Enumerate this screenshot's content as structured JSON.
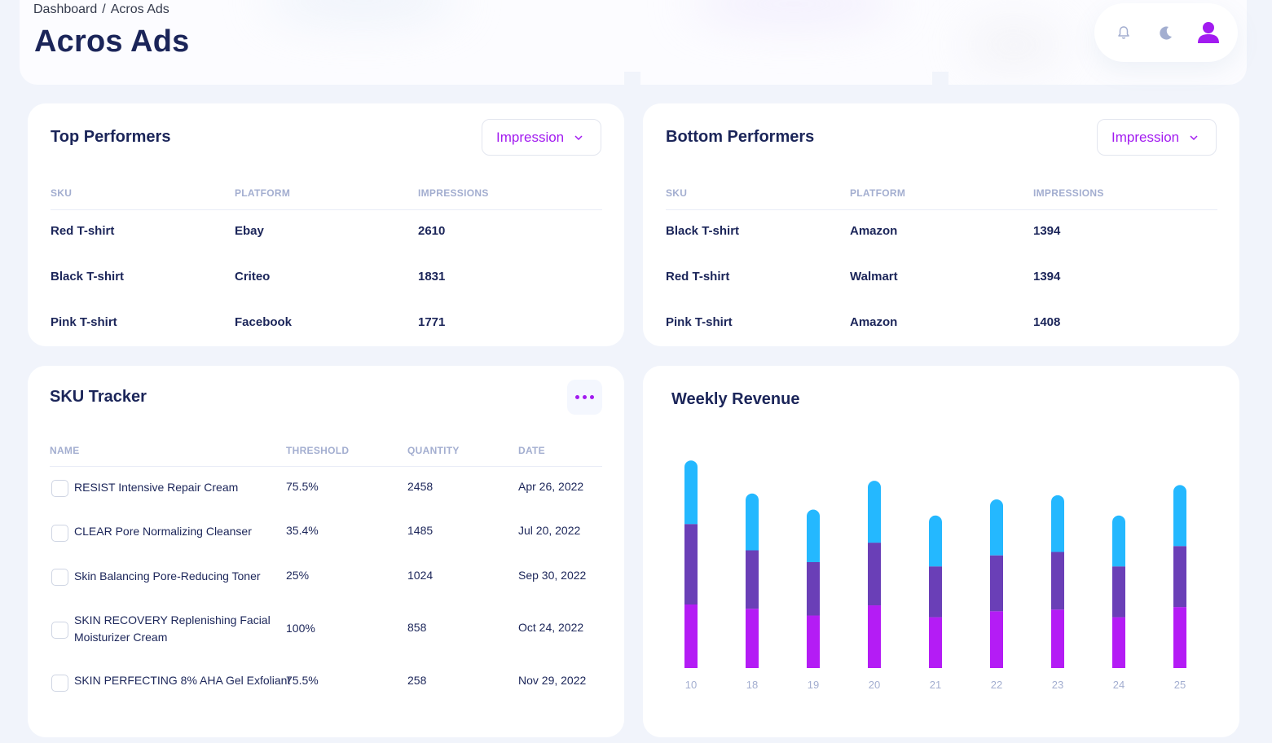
{
  "breadcrumb": {
    "root": "Dashboard",
    "separator": "/",
    "current": "Acros Ads"
  },
  "page_title": "Acros Ads",
  "header_icons": [
    "bell-icon",
    "moon-icon",
    "user-icon"
  ],
  "colors": {
    "accent": "#a21bf0",
    "navy": "#1b2559",
    "muted": "#a3aed0",
    "bar_top": "#24b8ff",
    "bar_mid": "#6a3fb7",
    "bar_bottom": "#b41cf5"
  },
  "top_performers": {
    "title": "Top Performers",
    "dropdown": "Impression",
    "columns": [
      "SKU",
      "PLATFORM",
      "IMPRESSIONS"
    ],
    "rows": [
      [
        "Red T-shirt",
        "Ebay",
        "2610"
      ],
      [
        "Black T-shirt",
        "Criteo",
        "1831"
      ],
      [
        "Pink T-shirt",
        "Facebook",
        "1771"
      ]
    ]
  },
  "bottom_performers": {
    "title": "Bottom Performers",
    "dropdown": "Impression",
    "columns": [
      "SKU",
      "PLATFORM",
      "IMPRESSIONS"
    ],
    "rows": [
      [
        "Black T-shirt",
        "Amazon",
        "1394"
      ],
      [
        "Red T-shirt",
        "Walmart",
        "1394"
      ],
      [
        "Pink T-shirt",
        "Amazon",
        "1408"
      ]
    ]
  },
  "sku_tracker": {
    "title": "SKU Tracker",
    "columns": [
      "NAME",
      "THRESHOLD",
      "QUANTITY",
      "DATE"
    ],
    "rows": [
      {
        "name": "RESIST Intensive Repair Cream",
        "threshold": "75.5%",
        "quantity": "2458",
        "date": "Apr 26, 2022",
        "checked": false
      },
      {
        "name": "CLEAR Pore Normalizing Cleanser",
        "threshold": "35.4%",
        "quantity": "1485",
        "date": "Jul 20, 2022",
        "checked": false
      },
      {
        "name": "Skin Balancing Pore-Reducing Toner",
        "threshold": "25%",
        "quantity": "1024",
        "date": "Sep 30, 2022",
        "checked": false
      },
      {
        "name": "SKIN RECOVERY Replenishing Facial Moisturizer Cream",
        "threshold": "100%",
        "quantity": "858",
        "date": "Oct 24, 2022",
        "checked": false
      },
      {
        "name": "SKIN PERFECTING 8% AHA Gel Exfoliant",
        "threshold": "75.5%",
        "quantity": "258",
        "date": "Nov 29, 2022",
        "checked": false
      }
    ]
  },
  "weekly_revenue": {
    "title": "Weekly Revenue"
  },
  "chart_data": {
    "type": "bar",
    "stacked": true,
    "title": "Weekly Revenue",
    "categories": [
      "10",
      "18",
      "19",
      "20",
      "21",
      "22",
      "23",
      "24",
      "25"
    ],
    "series": [
      {
        "values": [
          75,
          70,
          62,
          74,
          60,
          67,
          69,
          60,
          72
        ]
      },
      {
        "values": [
          95,
          69,
          63,
          74,
          60,
          66,
          68,
          60,
          72
        ]
      },
      {
        "values": [
          75,
          67,
          62,
          73,
          60,
          66,
          67,
          60,
          72
        ]
      }
    ],
    "ylim": [
      0,
      250
    ],
    "grid": false,
    "legend": "none"
  }
}
